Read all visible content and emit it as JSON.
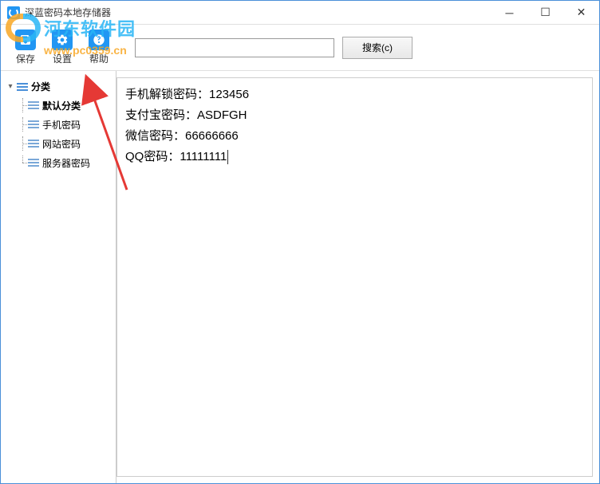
{
  "window": {
    "title": "深蓝密码本地存储器"
  },
  "toolbar": {
    "save_label": "保存",
    "settings_label": "设置",
    "help_label": "帮助"
  },
  "search": {
    "button_label": "搜索(c)",
    "input_value": ""
  },
  "sidebar": {
    "root_label": "分类",
    "items": [
      {
        "label": "默认分类",
        "selected": true
      },
      {
        "label": "手机密码",
        "selected": false
      },
      {
        "label": "网站密码",
        "selected": false
      },
      {
        "label": "服务器密码",
        "selected": false
      }
    ]
  },
  "content": {
    "lines": [
      "手机解锁密码：123456",
      "支付宝密码：ASDFGH",
      "微信密码：66666666",
      "QQ密码：11111111"
    ]
  },
  "watermark": {
    "site_name": "河东软件园",
    "url": "www.pc0359.cn"
  }
}
